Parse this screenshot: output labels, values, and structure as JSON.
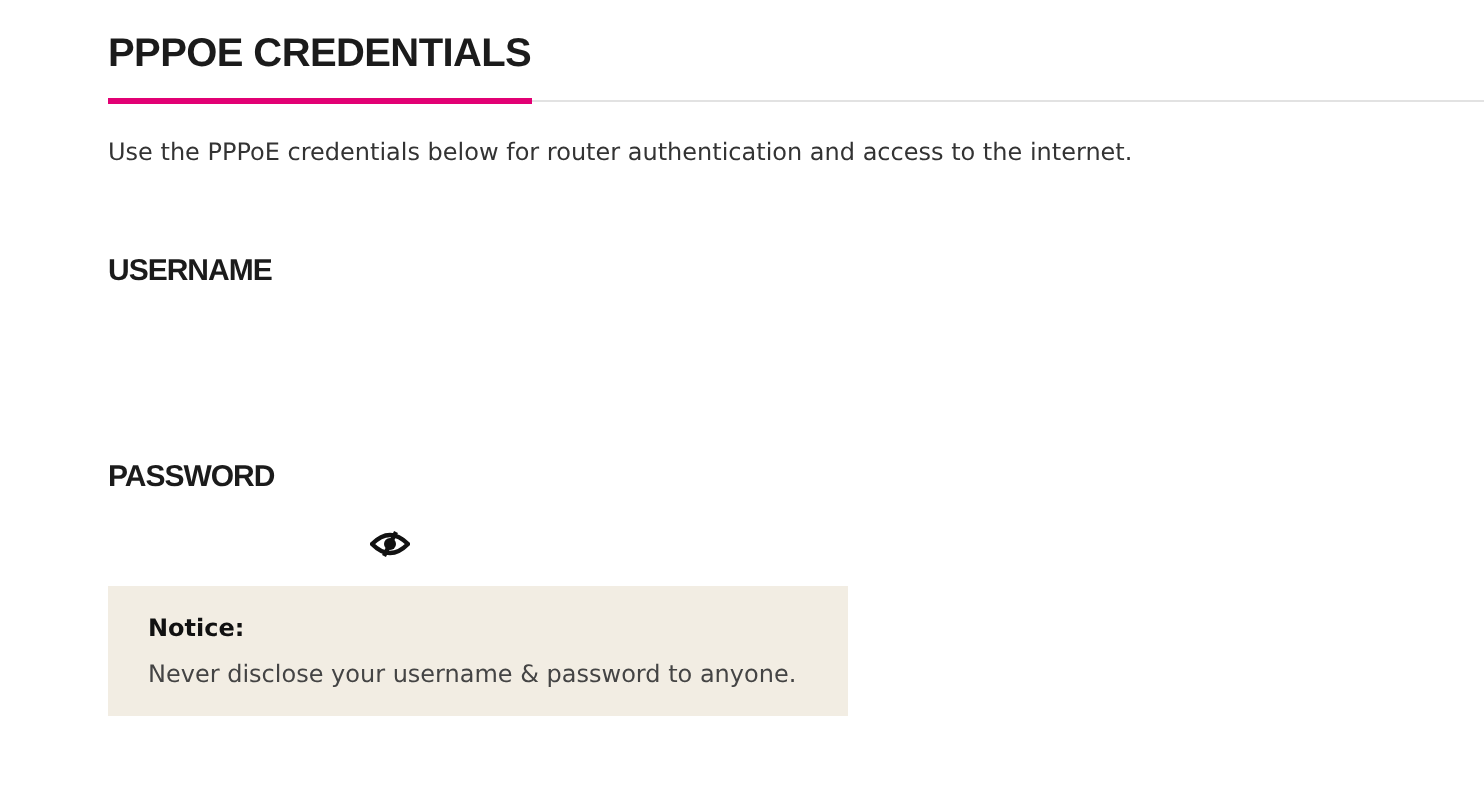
{
  "title": "PPPOE CREDENTIALS",
  "description": "Use the PPPoE credentials below for router authentication and access to the internet.",
  "fields": [
    {
      "label": "USERNAME",
      "kind": "text"
    },
    {
      "label": "PASSWORD",
      "kind": "password"
    }
  ],
  "notice": {
    "title": "Notice:",
    "text": "Never disclose your username & password to anyone."
  }
}
